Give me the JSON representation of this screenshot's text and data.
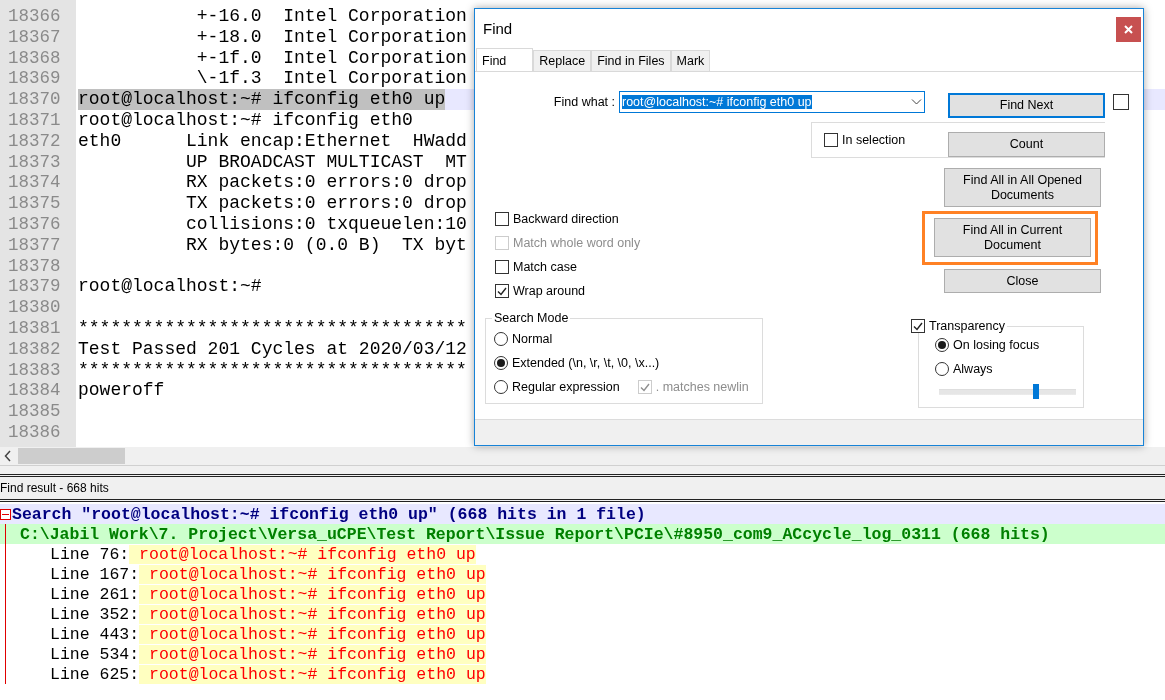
{
  "editor": {
    "lines": [
      {
        "number": "18366",
        "text": "           +-16.0  Intel Corporation",
        "selected": false
      },
      {
        "number": "18367",
        "text": "           +-18.0  Intel Corporation",
        "selected": false
      },
      {
        "number": "18368",
        "text": "           +-1f.0  Intel Corporation",
        "selected": false
      },
      {
        "number": "18369",
        "text": "           \\-1f.3  Intel Corporation",
        "selected": false
      },
      {
        "number": "18370",
        "text": "root@localhost:~# ifconfig eth0 up",
        "selected": true
      },
      {
        "number": "18371",
        "text": "root@localhost:~# ifconfig eth0",
        "selected": false
      },
      {
        "number": "18372",
        "text": "eth0      Link encap:Ethernet  HWadd",
        "selected": false
      },
      {
        "number": "18373",
        "text": "          UP BROADCAST MULTICAST  MT",
        "selected": false
      },
      {
        "number": "18374",
        "text": "          RX packets:0 errors:0 drop",
        "selected": false
      },
      {
        "number": "18375",
        "text": "          TX packets:0 errors:0 drop",
        "selected": false
      },
      {
        "number": "18376",
        "text": "          collisions:0 txqueuelen:10",
        "selected": false
      },
      {
        "number": "18377",
        "text": "          RX bytes:0 (0.0 B)  TX byt",
        "selected": false
      },
      {
        "number": "18378",
        "selected": false
      },
      {
        "number": "18379",
        "text": "root@localhost:~#",
        "selected": false
      },
      {
        "number": "18380",
        "selected": false
      },
      {
        "number": "18381",
        "text": "************************************",
        "selected": false
      },
      {
        "number": "18382",
        "text": "Test Passed 201 Cycles at 2020/03/12",
        "selected": false
      },
      {
        "number": "18383",
        "text": "************************************",
        "selected": false
      },
      {
        "number": "18384",
        "text": "poweroff",
        "selected": false
      },
      {
        "number": "18385",
        "selected": false
      },
      {
        "number": "18386",
        "selected": false
      }
    ]
  },
  "find_result": {
    "title": "Find result - 668 hits",
    "search": "Search \"root@localhost:~# ifconfig eth0 up\" (668 hits in 1 file)",
    "file": "C:\\Jabil Work\\7. Project\\Versa_uCPE\\Test Report\\Issue Report\\PCIe\\#8950_com9_ACcycle_log_0311 (668 hits)",
    "hits": [
      {
        "line": "Line 76:",
        "text": "root@localhost:~# ifconfig eth0 up"
      },
      {
        "line": "Line 167:",
        "text": "root@localhost:~# ifconfig eth0 up"
      },
      {
        "line": "Line 261:",
        "text": "root@localhost:~# ifconfig eth0 up"
      },
      {
        "line": "Line 352:",
        "text": "root@localhost:~# ifconfig eth0 up"
      },
      {
        "line": "Line 443:",
        "text": "root@localhost:~# ifconfig eth0 up"
      },
      {
        "line": "Line 534:",
        "text": "root@localhost:~# ifconfig eth0 up"
      },
      {
        "line": "Line 625:",
        "text": "root@localhost:~# ifconfig eth0 up"
      }
    ]
  },
  "dialog": {
    "title": "Find",
    "tabs": [
      {
        "label": "Find",
        "selected": true
      },
      {
        "label": "Replace",
        "selected": false
      },
      {
        "label": "Find in Files",
        "selected": false
      },
      {
        "label": "Mark",
        "selected": false
      }
    ],
    "find_what": {
      "label": "Find what :",
      "value": "root@localhost:~# ifconfig eth0 up"
    },
    "find_next_checkbox": {
      "checked": false
    },
    "in_selection": {
      "label": "In selection",
      "checked": false
    },
    "buttons": [
      {
        "label": "Find Next",
        "default": true,
        "outlined": false
      },
      {
        "label": "Count",
        "default": false,
        "outlined": false
      },
      {
        "label": "Find All in All Opened Documents",
        "default": false,
        "outlined": false
      },
      {
        "label": "Find All in Current Document",
        "default": false,
        "outlined": true
      },
      {
        "label": "Close",
        "default": false,
        "outlined": false
      }
    ],
    "options": [
      {
        "label": "Backward direction",
        "checked": false,
        "disabled": false
      },
      {
        "label": "Match whole word only",
        "checked": false,
        "disabled": true
      },
      {
        "label": "Match case",
        "checked": false,
        "disabled": false
      },
      {
        "label": "Wrap around",
        "checked": true,
        "disabled": false
      }
    ],
    "search_mode": {
      "title": "Search Mode",
      "options": [
        {
          "label": "Normal",
          "selected": false
        },
        {
          "label": "Extended (\\n, \\r, \\t, \\0, \\x...)",
          "selected": true
        },
        {
          "label": "Regular expression",
          "selected": false
        }
      ],
      "matches_newline": {
        "label": ". matches newlin",
        "checked": true,
        "disabled": true
      }
    },
    "transparency": {
      "label": "Transparency",
      "checked": true,
      "options": [
        {
          "label": "On losing focus",
          "selected": true
        },
        {
          "label": "Always",
          "selected": false
        }
      ],
      "level": 0.71
    }
  }
}
